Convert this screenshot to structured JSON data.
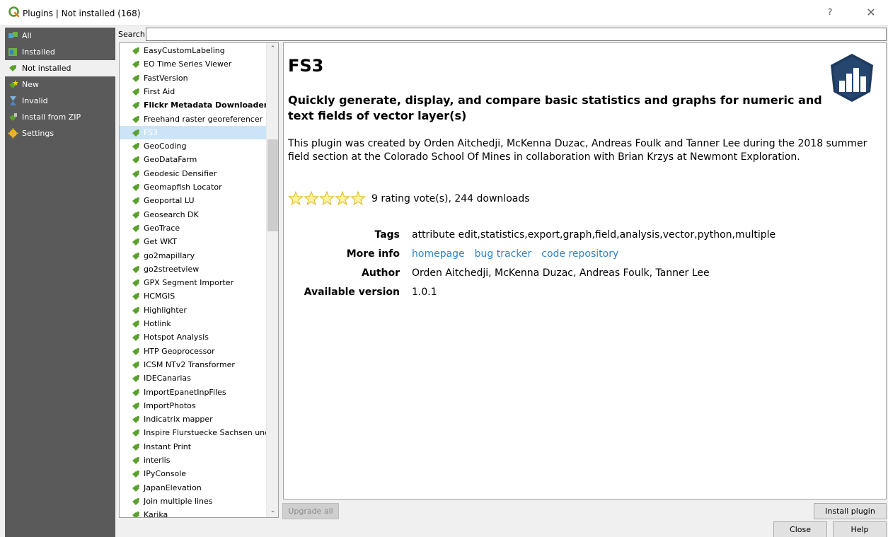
{
  "window": {
    "title": "Plugins | Not installed (168)",
    "help_glyph": "?",
    "close_glyph": "✕"
  },
  "sidebar": {
    "items": [
      {
        "label": "All",
        "icon": "puzzle-all-icon"
      },
      {
        "label": "Installed",
        "icon": "puzzle-installed-icon"
      },
      {
        "label": "Not installed",
        "icon": "puzzle-not-installed-icon"
      },
      {
        "label": "New",
        "icon": "puzzle-new-icon"
      },
      {
        "label": "Invalid",
        "icon": "puzzle-invalid-icon"
      },
      {
        "label": "Install from ZIP",
        "icon": "zip-icon"
      },
      {
        "label": "Settings",
        "icon": "gear-icon"
      }
    ],
    "active_index": 2
  },
  "search": {
    "label": "Search",
    "value": ""
  },
  "plugins": [
    "EasyCustomLabeling",
    "EO Time Series Viewer",
    "FastVersion",
    "First Aid",
    "Flickr Metadata Downloader",
    "Freehand raster georeferencer",
    "FS3",
    "GeoCoding",
    "GeoDataFarm",
    "Geodesic Densifier",
    "Geomapfish Locator",
    "Geoportal LU",
    "Geosearch DK",
    "GeoTrace",
    "Get WKT",
    "go2mapillary",
    "go2streetview",
    "GPX Segment Importer",
    "HCMGIS",
    "Highlighter",
    "Hotlink",
    "Hotspot Analysis",
    "HTP Geoprocessor",
    "ICSM NTv2 Transformer",
    "IDECanarias",
    "ImportEpanetInpFiles",
    "ImportPhotos",
    "Indicatrix mapper",
    "Inspire Flurstuecke Sachsen und T",
    "Instant Print",
    "interlis",
    "IPyConsole",
    "JapanElevation",
    "Join multiple lines",
    "Karika"
  ],
  "plugins_bold": [
    "Flickr Metadata Downloader"
  ],
  "selected_plugin": "FS3",
  "details": {
    "name": "FS3",
    "summary": "Quickly generate, display, and compare basic statistics and graphs for numeric and text fields of vector layer(s)",
    "description": "This plugin was created by Orden Aitchedji, McKenna Duzac, Andreas Foulk and Tanner Lee during the 2018 summer field section at the Colorado School Of Mines in collaboration with Brian Krzys at Newmont Exploration.",
    "rating_stars": 5,
    "rating_text": "9 rating vote(s), 244 downloads",
    "tags_label": "Tags",
    "tags": "attribute edit,statistics,export,graph,field,analysis,vector,python,multiple",
    "more_info_label": "More info",
    "links": {
      "homepage": "homepage",
      "bug_tracker": "bug tracker",
      "code_repository": "code repository"
    },
    "author_label": "Author",
    "author": "Orden Aitchedji, McKenna Duzac, Andreas Foulk, Tanner Lee",
    "version_label": "Available version",
    "version": "1.0.1"
  },
  "buttons": {
    "upgrade_all": "Upgrade all",
    "install_plugin": "Install plugin",
    "close": "Close",
    "help": "Help"
  },
  "colors": {
    "sidebar_bg": "#5a5a5a",
    "link": "#2c84c7",
    "selection": "#cce4f7",
    "plugin_icon": "#5aa02c"
  }
}
